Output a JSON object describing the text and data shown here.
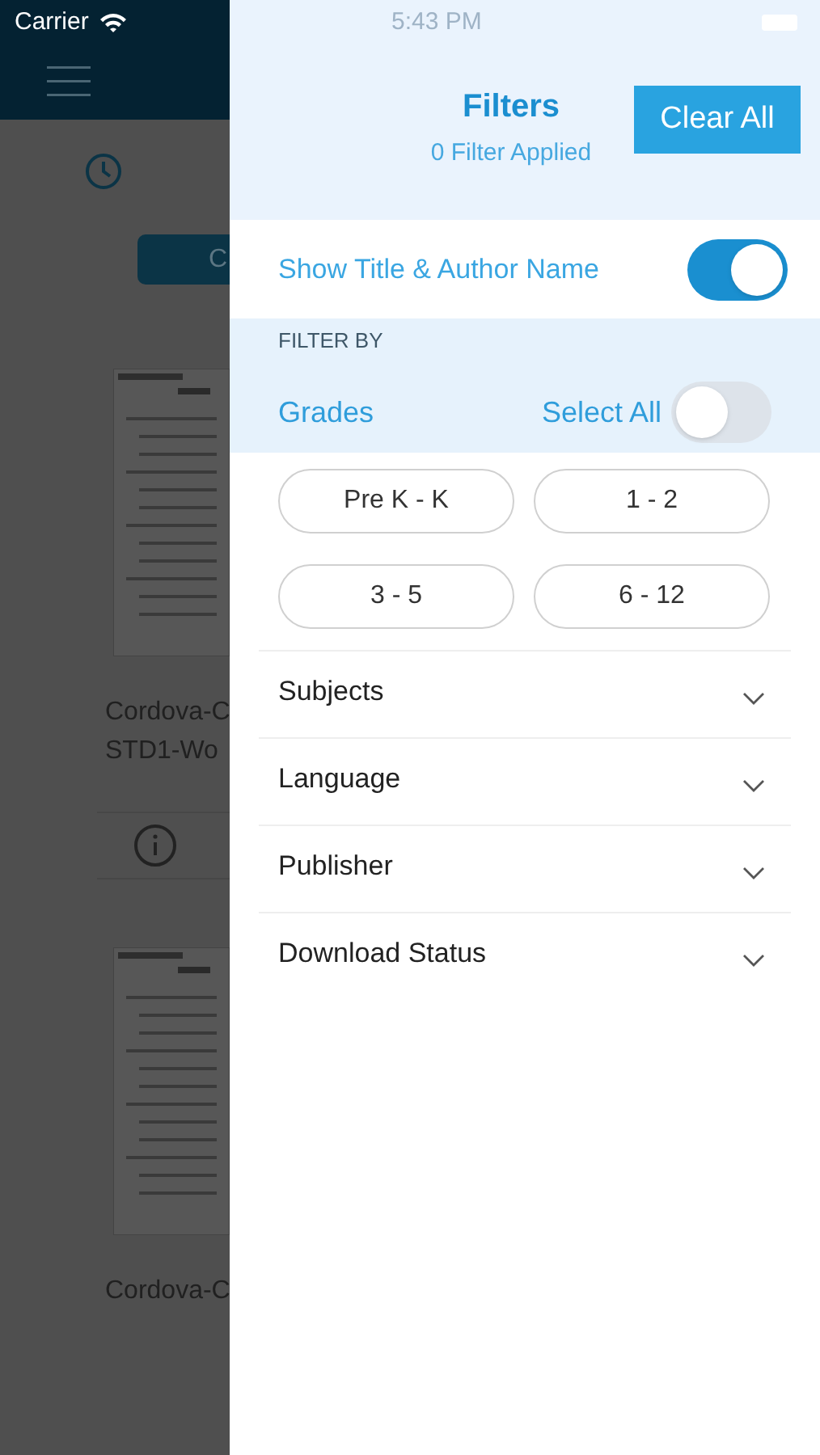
{
  "status_bar": {
    "carrier": "Carrier",
    "time": "5:43 PM"
  },
  "background": {
    "button_label": "C",
    "items": [
      {
        "title_lines": [
          "Cordova-C",
          "STD1-Wo"
        ]
      },
      {
        "title_lines": [
          "Cordova-C"
        ]
      }
    ]
  },
  "filters": {
    "title": "Filters",
    "subtitle": "0 Filter Applied",
    "clear_button": "Clear All",
    "show_title": {
      "label": "Show Title & Author Name",
      "on": true
    },
    "section_label": "FILTER BY",
    "grades": {
      "label": "Grades",
      "select_all": {
        "label": "Select All",
        "on": false
      },
      "options": [
        {
          "label": "Pre K - K",
          "selected": false
        },
        {
          "label": "1 - 2",
          "selected": false
        },
        {
          "label": "3 - 5",
          "selected": false
        },
        {
          "label": "6 - 12",
          "selected": false
        }
      ]
    },
    "sections": [
      {
        "label": "Subjects",
        "expanded": false
      },
      {
        "label": "Language",
        "expanded": false
      },
      {
        "label": "Publisher",
        "expanded": false
      },
      {
        "label": "Download Status",
        "expanded": false
      }
    ]
  }
}
